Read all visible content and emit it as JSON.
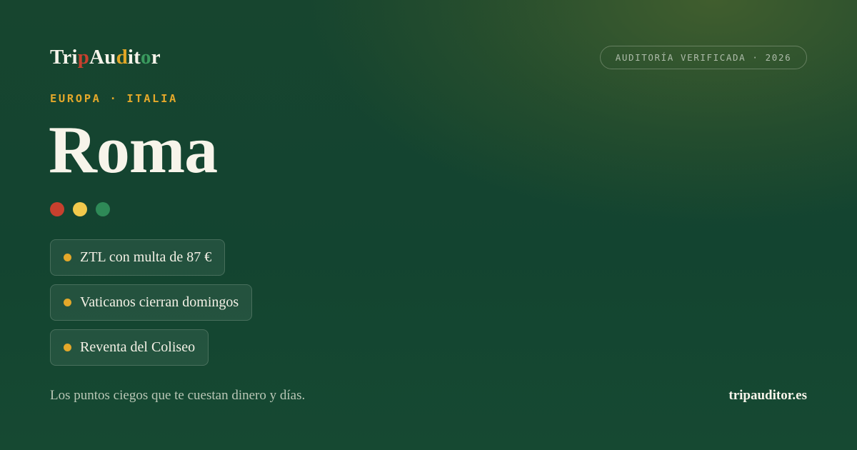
{
  "brand": {
    "logo_parts": [
      {
        "text": "Tri",
        "color": "#f7f4ea"
      },
      {
        "text": "p",
        "color": "#c7402e"
      },
      {
        "text": "Au",
        "color": "#f7f4ea"
      },
      {
        "text": "d",
        "color": "#e0a626"
      },
      {
        "text": "it",
        "color": "#f7f4ea"
      },
      {
        "text": "o",
        "color": "#3a9a5e"
      },
      {
        "text": "r",
        "color": "#f7f4ea"
      }
    ]
  },
  "badge": {
    "text": "AUDITORÍA VERIFICADA · 2026"
  },
  "region": {
    "text": "EUROPA · ITALIA"
  },
  "city": {
    "name": "Roma"
  },
  "flag_dots": [
    {
      "color": "#c7402e"
    },
    {
      "color": "#f2c94c"
    },
    {
      "color": "#2e8a57"
    }
  ],
  "highlights": [
    {
      "text": "ZTL con multa de 87 €"
    },
    {
      "text": "Vaticanos cierran domingos"
    },
    {
      "text": "Reventa del Coliseo"
    }
  ],
  "footer": {
    "tagline": "Los puntos ciegos que te cuestan dinero y días.",
    "site": "tripauditor.es"
  },
  "colors": {
    "accent": "#e4a82a",
    "background": "#134430"
  }
}
